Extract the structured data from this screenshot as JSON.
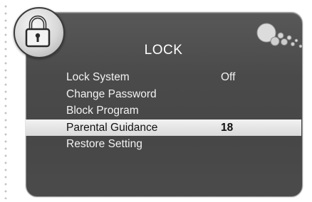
{
  "title": "LOCK",
  "menu": [
    {
      "label": "Lock System",
      "value": "Off",
      "selected": false
    },
    {
      "label": "Change Password",
      "value": "",
      "selected": false
    },
    {
      "label": "Block Program",
      "value": "",
      "selected": false
    },
    {
      "label": "Parental Guidance",
      "value": "18",
      "selected": true
    },
    {
      "label": "Restore Setting",
      "value": "",
      "selected": false
    }
  ],
  "icons": {
    "lock": "padlock-icon",
    "decor": "bubbles-icon"
  },
  "colors": {
    "panel": "#4a4a4a",
    "highlight": "#e6e6e6",
    "text": "#ffffff"
  }
}
